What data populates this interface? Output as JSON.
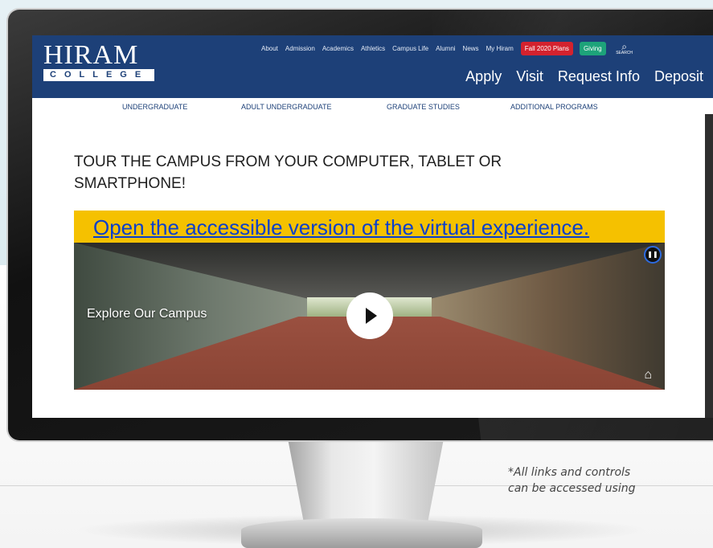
{
  "header": {
    "logo_word": "HIRAM",
    "logo_sub": "COLLEGE",
    "top_links": [
      "About",
      "Admission",
      "Academics",
      "Athletics",
      "Campus Life",
      "Alumni",
      "News",
      "My Hiram"
    ],
    "fall_plans": "Fall 2020 Plans",
    "giving": "Giving",
    "search_label": "SEARCH",
    "main_links": [
      "Apply",
      "Visit",
      "Request Info",
      "Deposit"
    ]
  },
  "subnav": [
    "UNDERGRADUATE",
    "ADULT UNDERGRADUATE",
    "GRADUATE STUDIES",
    "ADDITIONAL PROGRAMS"
  ],
  "page": {
    "title": "TOUR THE CAMPUS FROM YOUR COMPUTER, TABLET OR SMARTPHONE!",
    "accessible_link": "Open the accessible version of the virtual experience."
  },
  "video": {
    "label": "Explore Our Campus",
    "pause_glyph": "❚❚",
    "brand_glyph": "⌂"
  },
  "note": {
    "line1": "*All links and controls",
    "line2": "can be accessed using"
  },
  "colors": {
    "header_bg": "#1d4078",
    "fall_plans_bg": "#d4222e",
    "giving_bg": "#1da37a",
    "banner_bg": "#f5c100",
    "link_blue": "#0a3fcc"
  }
}
